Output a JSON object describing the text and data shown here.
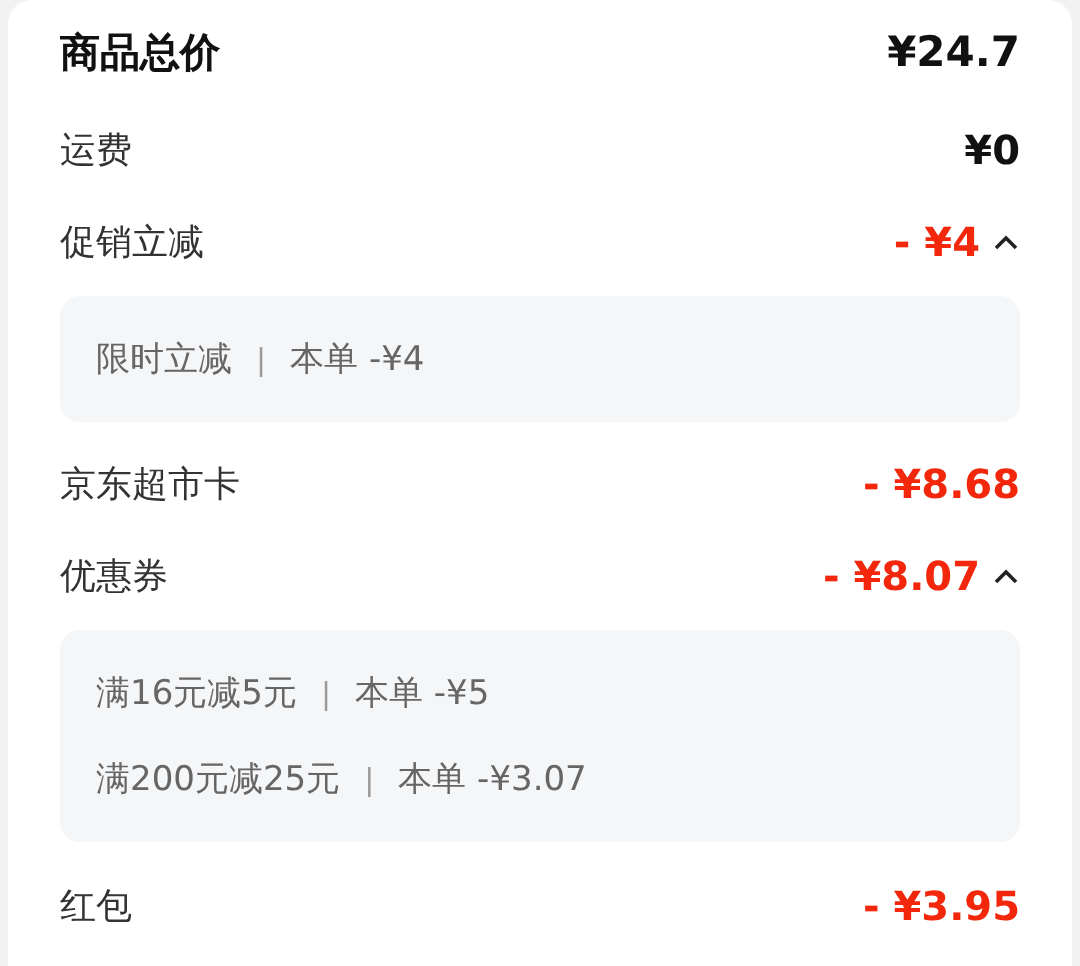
{
  "summary": {
    "label": "商品总价",
    "amount": "¥24.7"
  },
  "rows": [
    {
      "label": "运费",
      "amount": "¥0",
      "kind": "charge"
    },
    {
      "label": "促销立减",
      "amount": "- ¥4",
      "kind": "discount",
      "expanded": true,
      "details": [
        {
          "name": "限时立减",
          "separator": "|",
          "amount": "本单 -¥4"
        }
      ]
    },
    {
      "label": "京东超市卡",
      "amount": "- ¥8.68",
      "kind": "discount"
    },
    {
      "label": "优惠券",
      "amount": "- ¥8.07",
      "kind": "discount",
      "expanded": true,
      "details": [
        {
          "name": "满16元减5元",
          "separator": "|",
          "amount": "本单 -¥5"
        },
        {
          "name": "满200元减25元",
          "separator": "|",
          "amount": "本单 -¥3.07"
        }
      ]
    },
    {
      "label": "红包",
      "amount": "- ¥3.95",
      "kind": "discount"
    }
  ]
}
